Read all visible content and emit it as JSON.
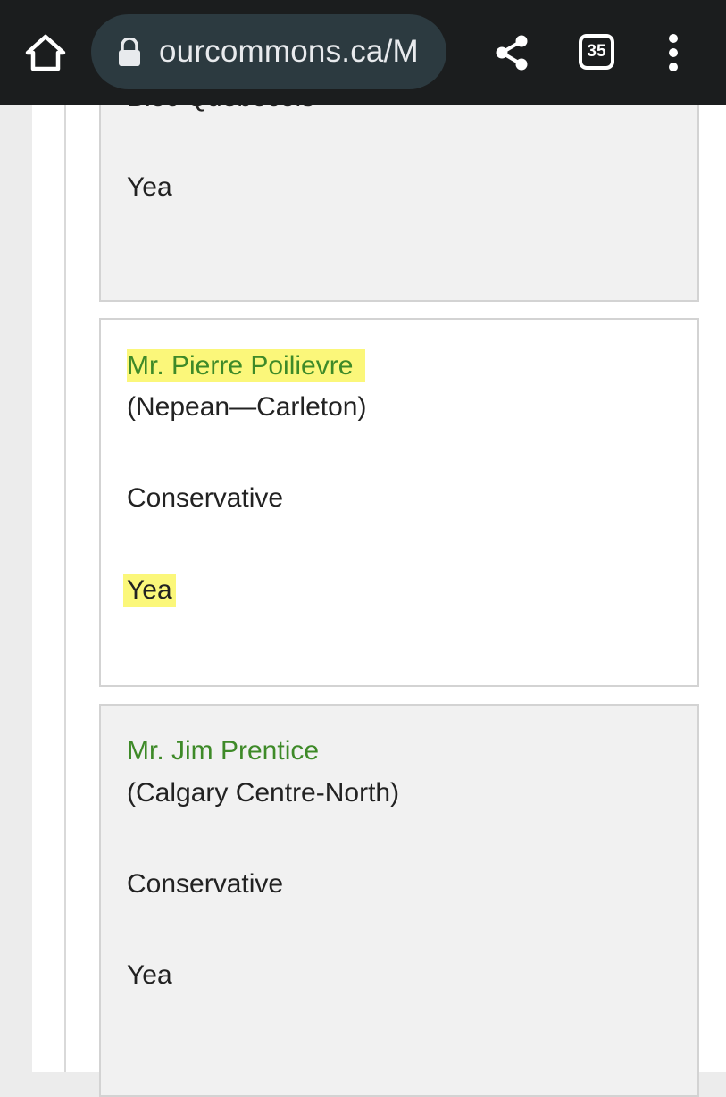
{
  "browser": {
    "url": "ourcommons.ca/M",
    "tab_count": "35",
    "icons": [
      "home-icon",
      "lock-icon",
      "share-icon",
      "tab-switcher-icon",
      "more-vert-icon"
    ],
    "colors": {
      "toolbar": "#1b1d1e",
      "urlbar": "#2c3a40"
    }
  },
  "votes": [
    {
      "party": "Bloc Québécois",
      "vote": "Yea",
      "highlighted": false
    },
    {
      "name": "Mr. Pierre Poilievre",
      "riding": "(Nepean—Carleton)",
      "party": "Conservative",
      "vote": "Yea",
      "highlighted": true
    },
    {
      "name": "Mr. Jim Prentice",
      "riding": "(Calgary Centre-North)",
      "party": "Conservative",
      "vote": "Yea",
      "highlighted": false
    }
  ],
  "colors": {
    "member_link": "#3e8a28",
    "highlight": "#fbf77a"
  }
}
